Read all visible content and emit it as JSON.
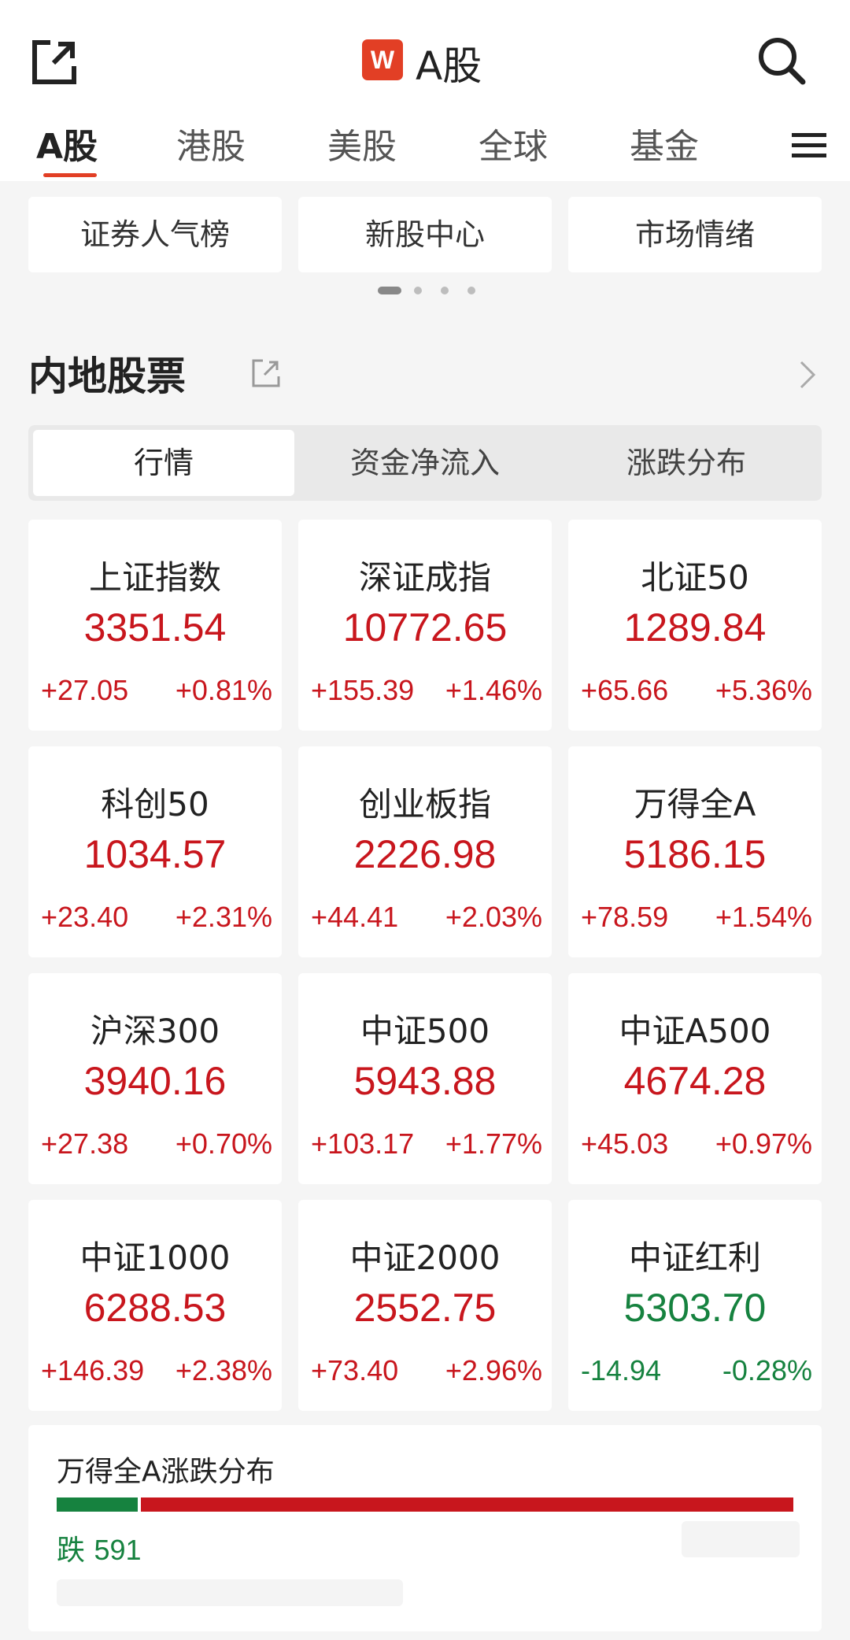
{
  "header": {
    "logo_text": "W",
    "title": "A股",
    "icons": {
      "share": "share-icon",
      "search": "search-icon",
      "menu": "menu-icon"
    }
  },
  "tabs": [
    "A股",
    "港股",
    "美股",
    "全球",
    "基金"
  ],
  "shortcuts": [
    "证券人气榜",
    "新股中心",
    "市场情绪"
  ],
  "section": {
    "title": "内地股票",
    "segments": [
      "行情",
      "资金净流入",
      "涨跌分布"
    ]
  },
  "indices": [
    {
      "name": "上证指数",
      "price": "3351.54",
      "change": "+27.05",
      "pct": "+0.81%"
    },
    {
      "name": "深证成指",
      "price": "10772.65",
      "change": "+155.39",
      "pct": "+1.46%"
    },
    {
      "name": "北证50",
      "price": "1289.84",
      "change": "+65.66",
      "pct": "+5.36%"
    },
    {
      "name": "科创50",
      "price": "1034.57",
      "change": "+23.40",
      "pct": "+2.31%"
    },
    {
      "name": "创业板指",
      "price": "2226.98",
      "change": "+44.41",
      "pct": "+2.03%"
    },
    {
      "name": "万得全A",
      "price": "5186.15",
      "change": "+78.59",
      "pct": "+1.54%"
    },
    {
      "name": "沪深300",
      "price": "3940.16",
      "change": "+27.38",
      "pct": "+0.70%"
    },
    {
      "name": "中证500",
      "price": "5943.88",
      "change": "+103.17",
      "pct": "+1.77%"
    },
    {
      "name": "中证A500",
      "price": "4674.28",
      "change": "+45.03",
      "pct": "+0.97%"
    },
    {
      "name": "中证1000",
      "price": "6288.53",
      "change": "+146.39",
      "pct": "+2.38%"
    },
    {
      "name": "中证2000",
      "price": "2552.75",
      "change": "+73.40",
      "pct": "+2.96%"
    },
    {
      "name": "中证红利",
      "price": "5303.70",
      "change": "-14.94",
      "pct": "-0.28%"
    }
  ],
  "distribution": {
    "title": "万得全A涨跌分布",
    "down_label": "跌",
    "down_count": "591",
    "down_fraction": 0.11
  },
  "colors": {
    "up": "#c8161d",
    "down": "#16823f",
    "accent": "#e23f25"
  }
}
